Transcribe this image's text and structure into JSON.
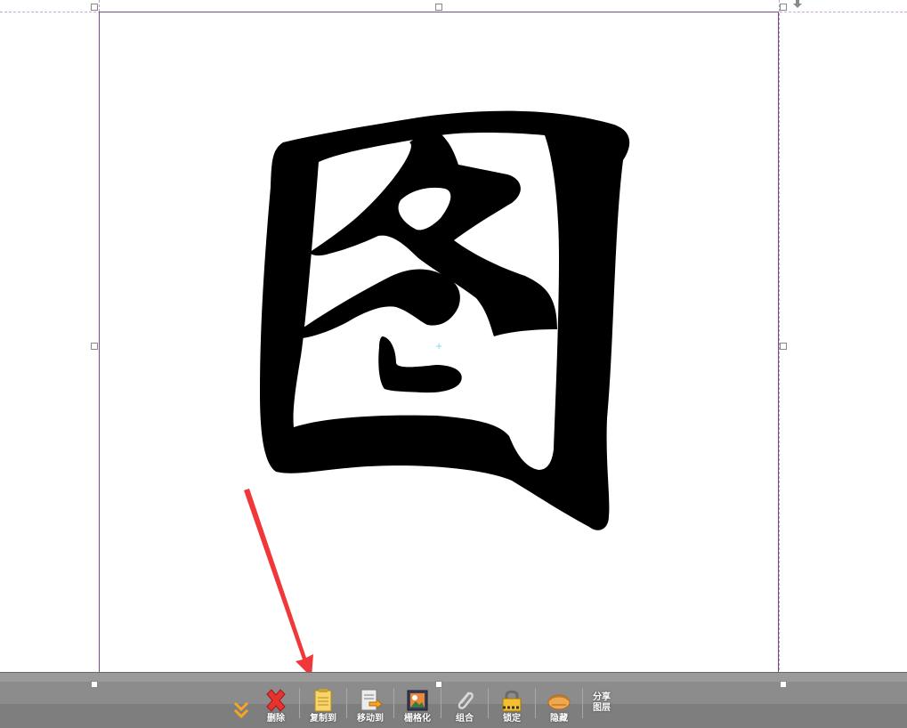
{
  "canvas": {
    "glyph_text": "图"
  },
  "toolbar": {
    "expand_label": "",
    "delete_label": "删除",
    "copy_to_label": "复制到",
    "move_to_label": "移动到",
    "rasterize_label": "栅格化",
    "group_label": "组合",
    "lock_label": "锁定",
    "hide_label": "隐藏",
    "share_layer_label": "分享图层"
  },
  "colors": {
    "annotation_arrow": "#f0383a",
    "selection_border": "#7a4a8a",
    "toolbar_bg": "#8c8c8c"
  }
}
